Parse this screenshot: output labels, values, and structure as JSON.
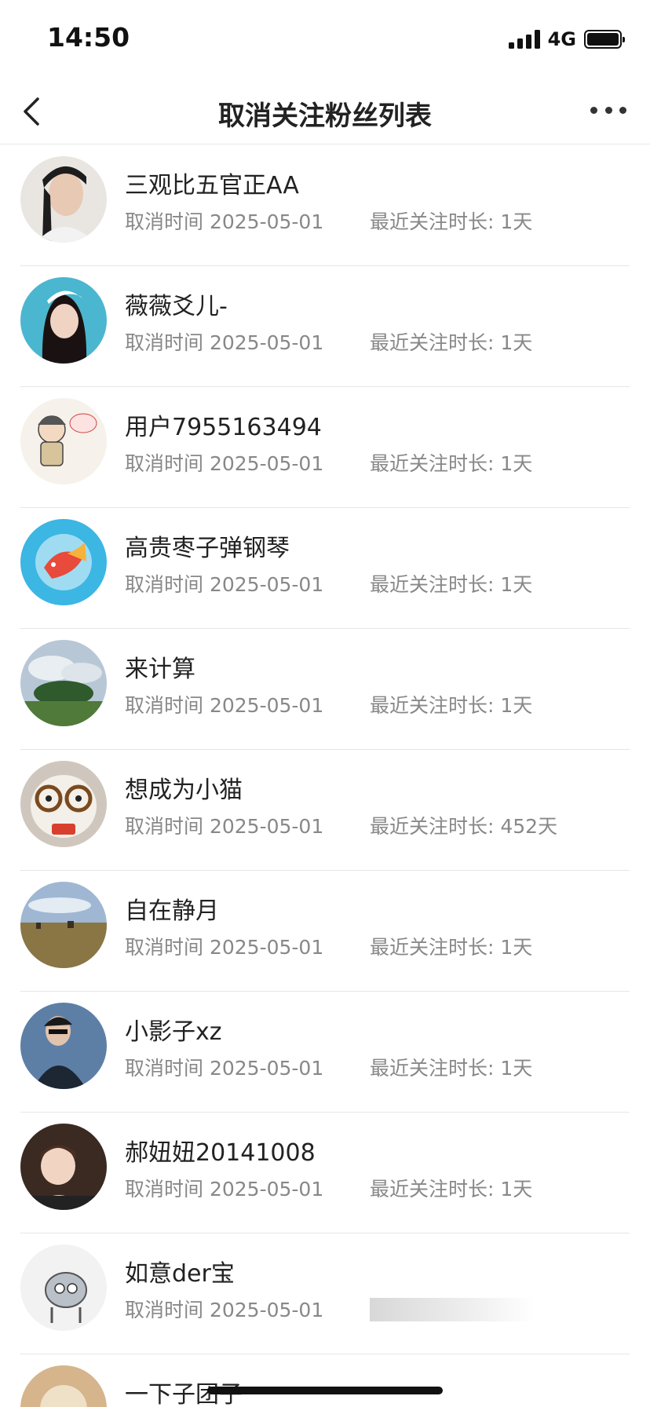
{
  "status_bar": {
    "time": "14:50",
    "network": "4G"
  },
  "nav": {
    "title": "取消关注粉丝列表"
  },
  "list": [
    {
      "name": "三观比五官正AA",
      "unfollow_label": "取消时间 2025-05-01",
      "duration_label": "最近关注时长: 1天"
    },
    {
      "name": "薇薇爻儿-",
      "unfollow_label": "取消时间 2025-05-01",
      "duration_label": "最近关注时长: 1天"
    },
    {
      "name": "用户7955163494",
      "unfollow_label": "取消时间 2025-05-01",
      "duration_label": "最近关注时长: 1天"
    },
    {
      "name": "高贵枣子弹钢琴",
      "unfollow_label": "取消时间 2025-05-01",
      "duration_label": "最近关注时长: 1天"
    },
    {
      "name": "来计算",
      "unfollow_label": "取消时间 2025-05-01",
      "duration_label": "最近关注时长: 1天"
    },
    {
      "name": "想成为小猫",
      "unfollow_label": "取消时间 2025-05-01",
      "duration_label": "最近关注时长: 452天"
    },
    {
      "name": "自在静月",
      "unfollow_label": "取消时间 2025-05-01",
      "duration_label": "最近关注时长: 1天"
    },
    {
      "name": "小影子xz",
      "unfollow_label": "取消时间 2025-05-01",
      "duration_label": "最近关注时长: 1天"
    },
    {
      "name": "郝妞妞20141008",
      "unfollow_label": "取消时间 2025-05-01",
      "duration_label": "最近关注时长: 1天"
    },
    {
      "name": "如意der宝",
      "unfollow_label": "取消时间 2025-05-01",
      "duration_label": ""
    },
    {
      "name": "一下子团子",
      "unfollow_label": "",
      "duration_label": ""
    }
  ]
}
